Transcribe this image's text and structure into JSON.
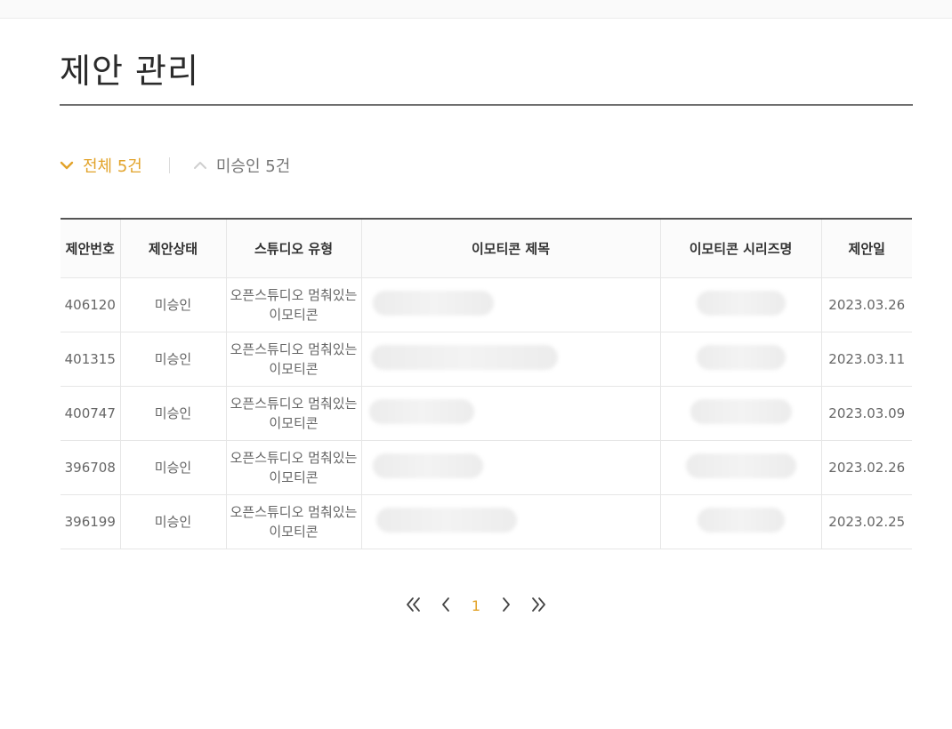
{
  "page": {
    "title": "제안 관리"
  },
  "filters": {
    "all_label": "전체 5건",
    "unapproved_label": "미승인 5건"
  },
  "table": {
    "headers": [
      "제안번호",
      "제안상태",
      "스튜디오 유형",
      "이모티콘 제목",
      "이모티콘 시리즈명",
      "제안일"
    ],
    "rows": [
      {
        "id": "406120",
        "status": "미승인",
        "studio": "오픈스튜디오 멈춰있는 이모티콘",
        "date": "2023.03.26"
      },
      {
        "id": "401315",
        "status": "미승인",
        "studio": "오픈스튜디오 멈춰있는 이모티콘",
        "date": "2023.03.11"
      },
      {
        "id": "400747",
        "status": "미승인",
        "studio": "오픈스튜디오 멈춰있는 이모티콘",
        "date": "2023.03.09"
      },
      {
        "id": "396708",
        "status": "미승인",
        "studio": "오픈스튜디오 멈춰있는 이모티콘",
        "date": "2023.02.26"
      },
      {
        "id": "396199",
        "status": "미승인",
        "studio": "오픈스튜디오 멈춰있는 이모티콘",
        "date": "2023.02.25"
      }
    ]
  },
  "pagination": {
    "current_page": "1"
  },
  "icons": {
    "filter_all": "chevron-down-icon",
    "filter_unapproved": "chevron-up-icon",
    "first": "double-chevron-left-icon",
    "prev": "chevron-left-icon",
    "next": "chevron-right-icon",
    "last": "double-chevron-right-icon"
  },
  "colors": {
    "accent": "#e2a32a",
    "status_unapproved": "#d67f7f"
  }
}
